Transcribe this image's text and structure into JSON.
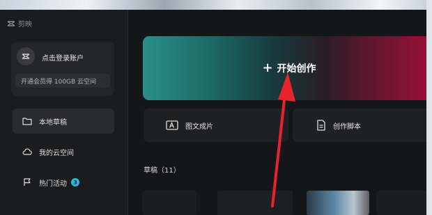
{
  "app": {
    "name": "剪映"
  },
  "account": {
    "login_text": "点击登录账户",
    "vip_promo": "开通会员得 100GB 云空间"
  },
  "sidebar": {
    "items": [
      {
        "label": "本地草稿",
        "icon": "folder-icon",
        "active": true
      },
      {
        "label": "我的云空间",
        "icon": "cloud-icon",
        "active": false
      },
      {
        "label": "热门活动",
        "icon": "flag-icon",
        "active": false,
        "badge": "3"
      }
    ]
  },
  "main": {
    "create_button": {
      "label": "开始创作",
      "icon": "plus-icon"
    },
    "quick_actions": [
      {
        "label": "图文成片",
        "icon": "text-image-icon"
      },
      {
        "label": "创作脚本",
        "icon": "script-document-icon"
      }
    ],
    "drafts": {
      "title": "草稿（11）"
    }
  },
  "colors": {
    "create_gradient_start": "#2a8f88",
    "create_gradient_end": "#9d1139",
    "badge": "#29b8d9",
    "annotation_arrow": "#e8242b"
  }
}
